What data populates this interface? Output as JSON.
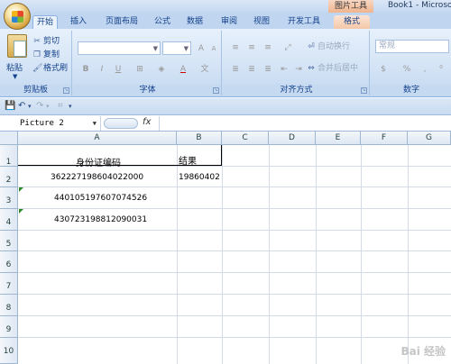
{
  "window": {
    "tool_tab_title": "图片工具",
    "title": "Book1 - Microso"
  },
  "tabs": [
    {
      "label": "开始"
    },
    {
      "label": "插入"
    },
    {
      "label": "页面布局"
    },
    {
      "label": "公式"
    },
    {
      "label": "数据"
    },
    {
      "label": "审阅"
    },
    {
      "label": "视图"
    },
    {
      "label": "开发工具"
    },
    {
      "label": "格式"
    }
  ],
  "ribbon": {
    "clipboard": {
      "paste": "粘贴",
      "cut": "剪切",
      "copy": "复制",
      "format_painter": "格式刷",
      "label": "剪贴板"
    },
    "font": {
      "font_name": "",
      "font_size": "",
      "bold": "B",
      "italic": "I",
      "underline": "U",
      "grow": "A",
      "shrink": "A",
      "font_color": "A",
      "label": "字体"
    },
    "alignment": {
      "wrap_text": "自动换行",
      "merge_center": "合并后居中",
      "label": "对齐方式"
    },
    "number": {
      "format": "常规",
      "percent": "%",
      "comma": ",",
      "label": "数字"
    }
  },
  "formula_bar": {
    "name_box": "Picture 2",
    "fx": "fx",
    "value": ""
  },
  "columns": [
    "A",
    "B",
    "C",
    "D",
    "E",
    "F",
    "G"
  ],
  "rows": [
    "1",
    "2",
    "3",
    "4",
    "5",
    "6",
    "7",
    "8",
    "9",
    "10"
  ],
  "cells": {
    "A1": "身份证编码",
    "B1": "结果",
    "A2": "362227198604022000",
    "B2": "19860402",
    "A3": "440105197607074526",
    "A4": "430723198812090031"
  },
  "watermark": "Bai 经验"
}
